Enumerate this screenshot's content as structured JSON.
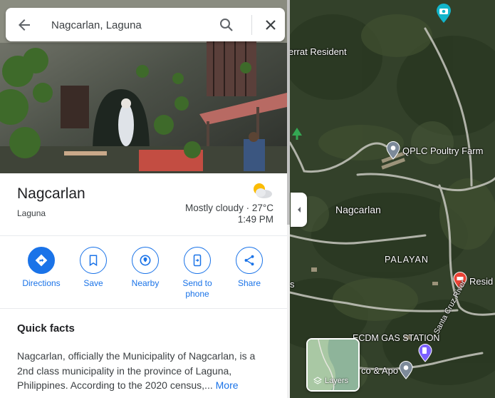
{
  "search": {
    "value": "Nagcarlan, Laguna"
  },
  "place": {
    "title": "Nagcarlan",
    "subtitle": "Laguna",
    "weather": "Mostly cloudy · 27°C",
    "time": "1:49 PM"
  },
  "actions": [
    {
      "label": "Directions",
      "icon": "directions-icon"
    },
    {
      "label": "Save",
      "icon": "bookmark-icon"
    },
    {
      "label": "Nearby",
      "icon": "nearby-icon"
    },
    {
      "label": "Send to phone",
      "icon": "phone-icon"
    },
    {
      "label": "Share",
      "icon": "share-icon"
    }
  ],
  "quick_facts": {
    "title": "Quick facts",
    "body": "Nagcarlan, officially the Municipality of Nagcarlan, is a 2nd class municipality in the province of Laguna, Philippines. According to the 2020 census,...",
    "more": "More"
  },
  "map": {
    "labels": {
      "resident_top": "errat Resident",
      "poultry": "QPLC Poultry Farm",
      "town": "Nagcarlan",
      "palayan": "PALAYAN",
      "resid_right": "Resid",
      "s_left": "s",
      "gas": "ECDM GAS STATION",
      "co_apo": "co & Apo",
      "river": "Santa Cruz River"
    },
    "layers_label": "Layers"
  },
  "colors": {
    "accent": "#1a73e8",
    "pin_red": "#ea4335",
    "pin_teal": "#12b5cb"
  }
}
